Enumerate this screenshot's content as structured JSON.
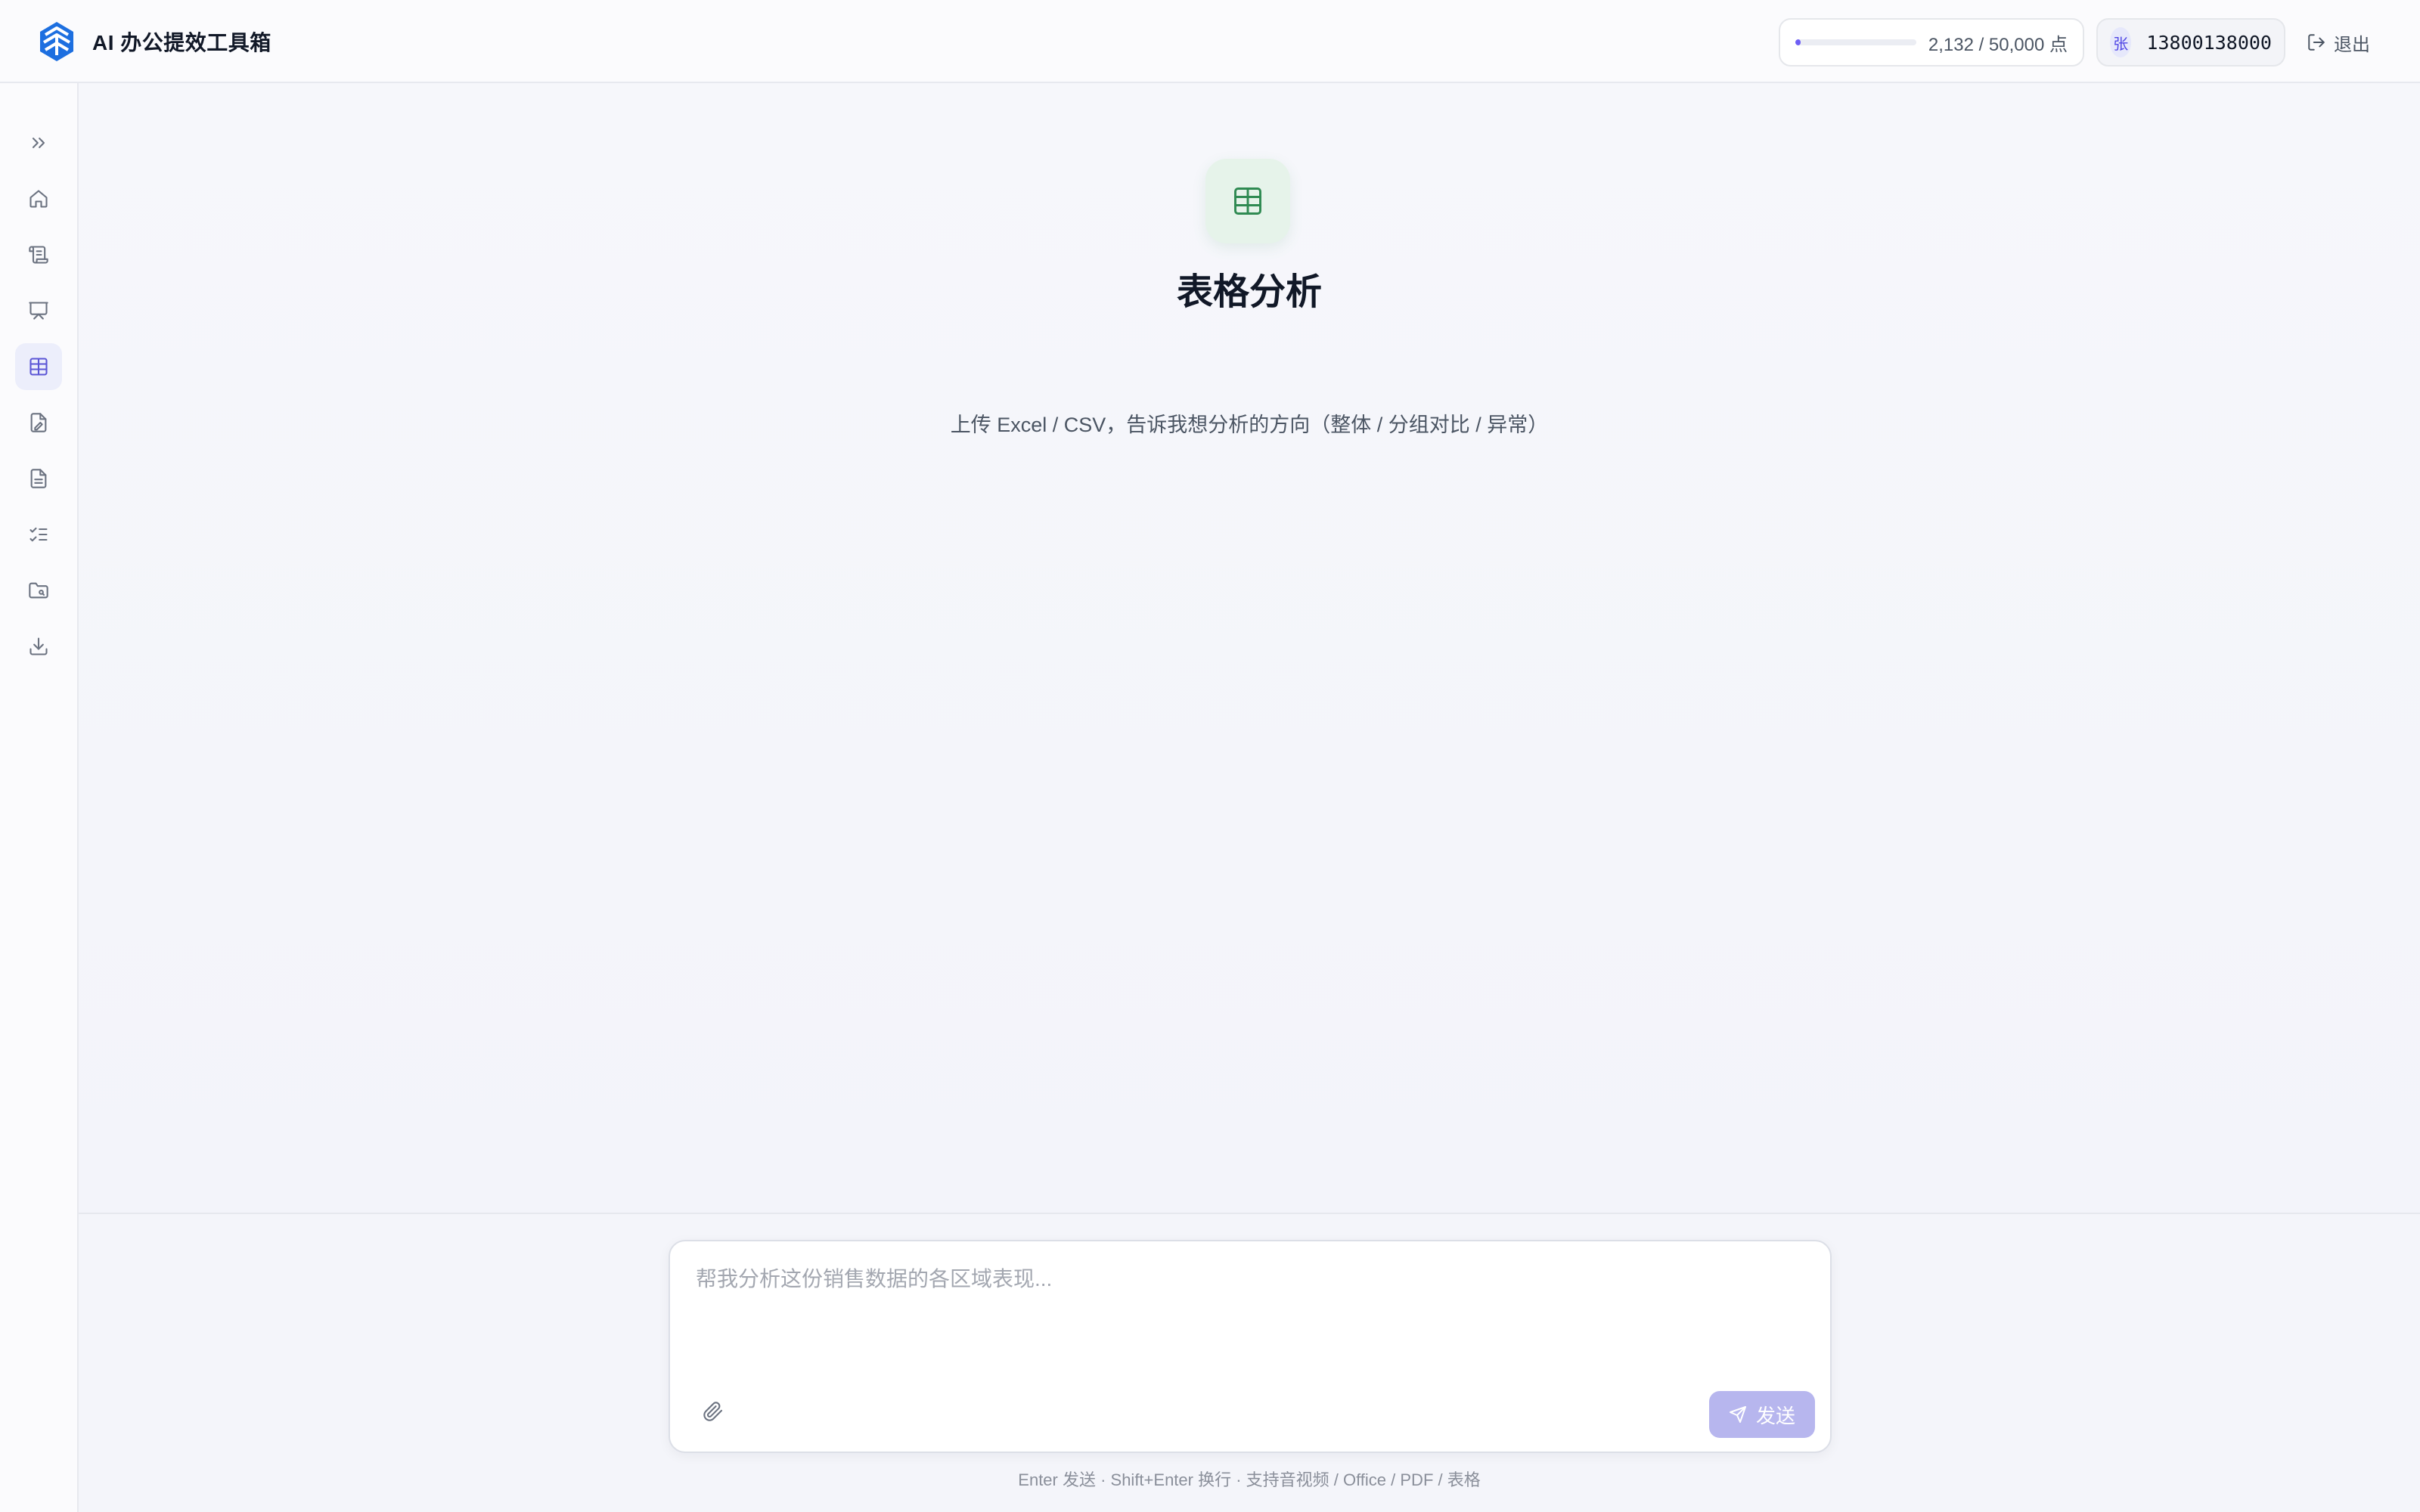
{
  "header": {
    "app_title": "AI 办公提效工具箱",
    "quota": {
      "used": 2132,
      "total": 50000,
      "label": "2,132 / 50,000 点"
    },
    "user": {
      "avatar_text": "张",
      "phone": "13800138000"
    },
    "logout_label": "退出"
  },
  "sidebar": {
    "items": [
      {
        "icon": "chevrons-right-icon",
        "name": "expand-sidebar"
      },
      {
        "icon": "home-icon",
        "name": "home"
      },
      {
        "icon": "scroll-icon",
        "name": "document-writing"
      },
      {
        "icon": "presentation-icon",
        "name": "presentation"
      },
      {
        "icon": "table-icon",
        "name": "table-analysis",
        "active": true
      },
      {
        "icon": "file-edit-icon",
        "name": "file-edit"
      },
      {
        "icon": "file-text-icon",
        "name": "file-text"
      },
      {
        "icon": "list-checks-icon",
        "name": "checklist"
      },
      {
        "icon": "folder-search-icon",
        "name": "folder"
      },
      {
        "icon": "download-icon",
        "name": "download"
      }
    ]
  },
  "main": {
    "hero_icon": "table-icon",
    "title": "表格分析",
    "subtitle": "上传 Excel / CSV，告诉我想分析的方向（整体 / 分组对比 / 异常）"
  },
  "composer": {
    "placeholder": "帮我分析这份销售数据的各区域表现...",
    "value": "",
    "send_label": "发送",
    "hint": "Enter 发送 · Shift+Enter 换行 · 支持音视频 / Office / PDF / 表格"
  },
  "colors": {
    "accent": "#6d5ef5",
    "send_button_disabled": "#b7b6ee",
    "table_icon_green": "#2f8a52",
    "brand_blue": "#1d6fe0"
  }
}
